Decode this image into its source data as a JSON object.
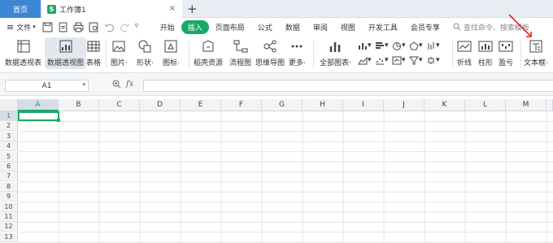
{
  "tabs": {
    "home": "首页",
    "file": "工作簿1",
    "file_icon": "S",
    "close": "×",
    "add": "+"
  },
  "menu": {
    "file": "文件",
    "tabs": [
      "开始",
      "插入",
      "页面布局",
      "公式",
      "数据",
      "审阅",
      "视图",
      "开发工具",
      "会员专享"
    ],
    "active_tab": "插入",
    "search_placeholder": "查找命令、搜索模板"
  },
  "ribbon": {
    "buttons": [
      {
        "label": "数据透视表"
      },
      {
        "label": "数据透视图"
      },
      {
        "label": "表格"
      },
      {
        "label": "图片·"
      },
      {
        "label": "形状·"
      },
      {
        "label": "图标·"
      },
      {
        "label": "稻壳资源"
      },
      {
        "label": "流程图"
      },
      {
        "label": "思维导图"
      },
      {
        "label": "更多·"
      },
      {
        "label": "全部图表·"
      },
      {
        "label": "折线"
      },
      {
        "label": "柱形"
      },
      {
        "label": "盈亏"
      },
      {
        "label": "文本框·"
      }
    ]
  },
  "formula_bar": {
    "cell_ref": "A1",
    "fx": "fx",
    "value": ""
  },
  "sheet": {
    "columns": [
      "A",
      "B",
      "C",
      "D",
      "E",
      "F",
      "G",
      "H",
      "I",
      "J",
      "K",
      "L",
      "M"
    ],
    "rows": [
      "1",
      "2",
      "3",
      "4",
      "5",
      "6",
      "7",
      "8",
      "9",
      "10",
      "11",
      "12",
      "13"
    ],
    "active_col": "A",
    "active_row": "1"
  },
  "colors": {
    "accent": "#1aa867",
    "home_tab": "#3d86d6",
    "annotation_arrow": "#e02020"
  }
}
